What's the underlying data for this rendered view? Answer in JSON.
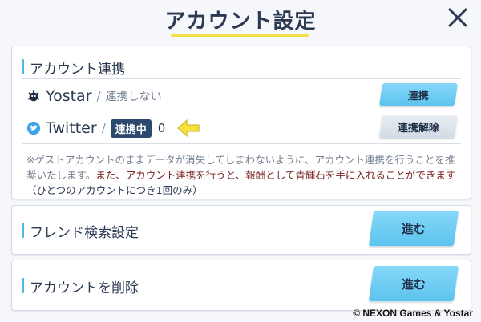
{
  "header": {
    "title": "アカウント設定",
    "close_icon": "close-x-icon"
  },
  "account_link": {
    "section_title": "アカウント連携",
    "separator": "/",
    "yostar": {
      "name": "Yostar",
      "status": "連携しない",
      "button_label": "連携",
      "icon": "yostar-logo-icon"
    },
    "twitter": {
      "name": "Twitter",
      "status_badge": "連携中",
      "count": "0",
      "button_label": "連携解除",
      "icon": "twitter-bird-icon"
    },
    "note": {
      "part_gray": "※ゲストアカウントのままデータが消失してしまわないように、アカウント連携を行うことを推奨いたします。",
      "part_red": "また、アカウント連携を行うと、報酬として青輝石を手に入れることができます",
      "part_dark": "（ひとつのアカウントにつき1回のみ）"
    }
  },
  "friend_search": {
    "label": "フレンド検索設定",
    "button_label": "進む"
  },
  "delete_account": {
    "label": "アカウントを削除",
    "button_label": "進む"
  },
  "copyright": "© NEXON Games & Yostar",
  "colors": {
    "accent_blue": "#5cc3ee",
    "badge_navy": "#2d4a6e",
    "title_underline": "#f0e043",
    "note_red": "#7a2626",
    "arrow_yellow": "#f5e23a"
  }
}
